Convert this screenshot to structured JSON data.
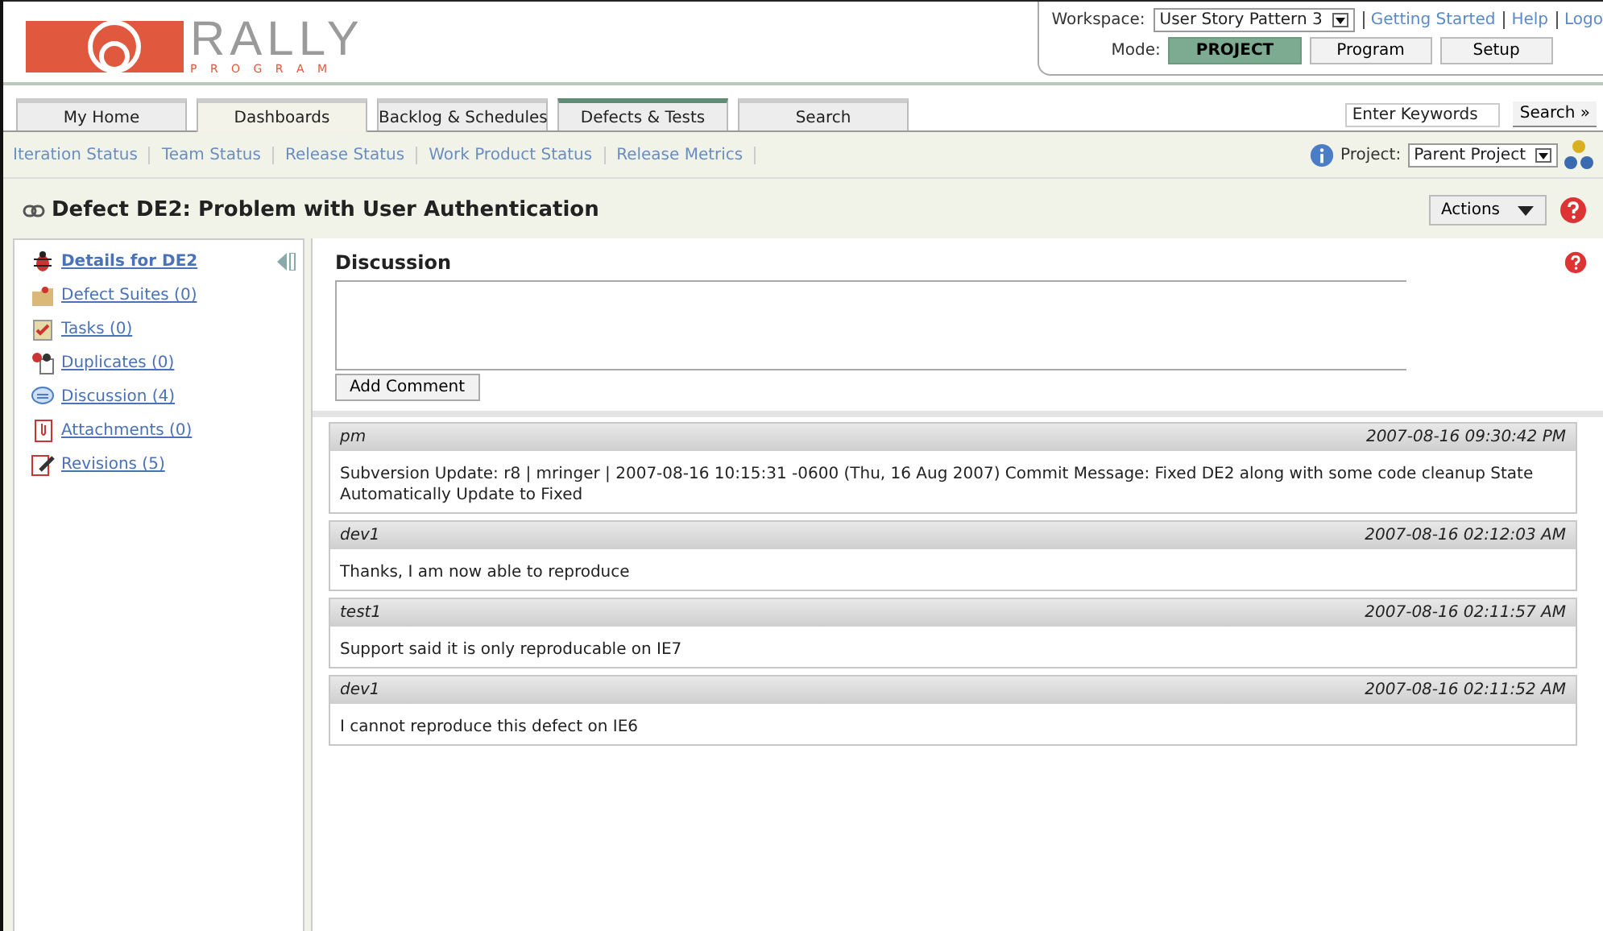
{
  "logo": {
    "name": "RALLY",
    "subtitle": "P R O G R A M"
  },
  "workspace": {
    "label": "Workspace:",
    "value": "User Story Pattern 3",
    "links": [
      "Getting Started",
      "Help",
      "Logo"
    ]
  },
  "mode": {
    "label": "Mode:",
    "options": [
      {
        "label": "PROJECT",
        "selected": true
      },
      {
        "label": "Program",
        "selected": false
      },
      {
        "label": "Setup",
        "selected": false
      }
    ]
  },
  "tabs": [
    {
      "label": "My Home",
      "selected": false,
      "highlighted": false
    },
    {
      "label": "Dashboards",
      "selected": true,
      "highlighted": false
    },
    {
      "label": "Backlog & Schedules",
      "selected": false,
      "highlighted": false
    },
    {
      "label": "Defects & Tests",
      "selected": false,
      "highlighted": true
    },
    {
      "label": "Search",
      "selected": false,
      "highlighted": false
    }
  ],
  "search": {
    "placeholder": "Enter Keywords",
    "button": "Search »"
  },
  "subnav": [
    "Iteration Status",
    "Team Status",
    "Release Status",
    "Work Product Status",
    "Release Metrics"
  ],
  "project": {
    "label": "Project:",
    "value": "Parent Project"
  },
  "page_title": "Defect DE2: Problem with User Authentication",
  "actions": "Actions",
  "sidebar": {
    "items": [
      {
        "kind": "bug",
        "label": "Details for DE2",
        "selected": true
      },
      {
        "kind": "folder",
        "label": "Defect Suites (0)",
        "selected": false
      },
      {
        "kind": "task",
        "label": "Tasks (0)",
        "selected": false
      },
      {
        "kind": "bugs",
        "label": "Duplicates (0)",
        "selected": false
      },
      {
        "kind": "chat",
        "label": "Discussion (4)",
        "selected": false
      },
      {
        "kind": "attach",
        "label": "Attachments (0)",
        "selected": false
      },
      {
        "kind": "edit",
        "label": "Revisions (5)",
        "selected": false
      }
    ]
  },
  "discussion": {
    "title": "Discussion",
    "button": "Add Comment"
  },
  "comments": [
    {
      "author": "pm",
      "time": "2007-08-16 09:30:42 PM",
      "text": "Subversion Update: r8 | mringer | 2007-08-16 10:15:31 -0600 (Thu, 16 Aug 2007) Commit Message: Fixed DE2 along with some code cleanup State Automatically Update to Fixed"
    },
    {
      "author": "dev1",
      "time": "2007-08-16 02:12:03 AM",
      "text": "Thanks, I am now able to reproduce"
    },
    {
      "author": "test1",
      "time": "2007-08-16 02:11:57 AM",
      "text": "Support said it is only reproducable on IE7"
    },
    {
      "author": "dev1",
      "time": "2007-08-16 02:11:52 AM",
      "text": "I cannot reproduce this defect on IE6"
    }
  ]
}
